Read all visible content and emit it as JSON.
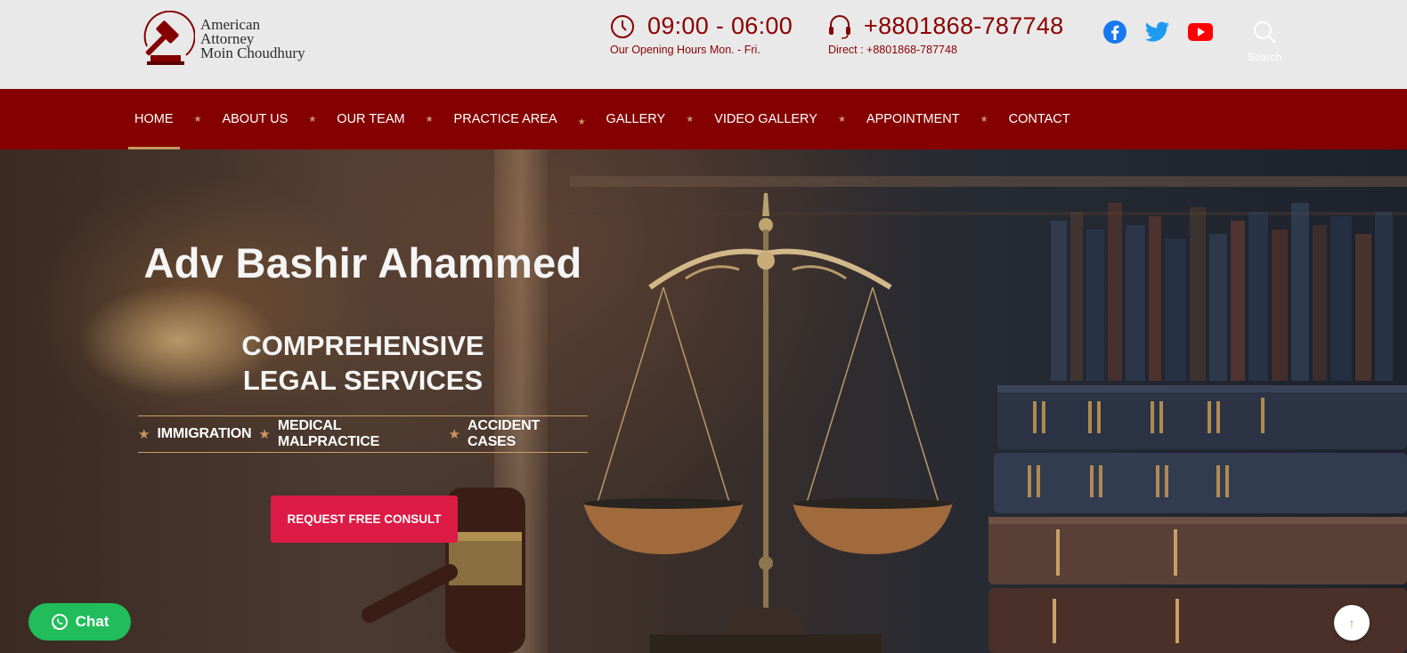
{
  "brand": {
    "logo_lines": [
      "American",
      "Attorney",
      "Moin Choudhury"
    ],
    "logo_icon": "gavel-icon",
    "primary_color": "#850000",
    "accent_color": "#c89862",
    "cta_color": "#dc1b46"
  },
  "header": {
    "hours": {
      "icon": "clock-icon",
      "value": "09:00 - 06:00",
      "caption": "Our Opening Hours Mon. - Fri."
    },
    "phone": {
      "icon": "headset-icon",
      "value": "+8801868-787748",
      "caption": "Direct : +8801868-787748"
    },
    "social": [
      {
        "icon": "facebook-icon",
        "color": "#1877f2"
      },
      {
        "icon": "twitter-icon",
        "color": "#1d9bf0"
      },
      {
        "icon": "youtube-icon",
        "color": "#ff0000"
      }
    ],
    "search": {
      "icon": "search-icon",
      "label": "Search"
    }
  },
  "nav": {
    "items": [
      {
        "label": "HOME",
        "active": true
      },
      {
        "label": "ABOUT US"
      },
      {
        "label": "OUR TEAM"
      },
      {
        "label": "PRACTICE AREA"
      },
      {
        "label": "GALLERY"
      },
      {
        "label": "VIDEO GALLERY"
      },
      {
        "label": "APPOINTMENT"
      },
      {
        "label": "CONTACT"
      }
    ]
  },
  "hero": {
    "name": "Adv Bashir Ahammed",
    "subtitle_line1": "COMPREHENSIVE",
    "subtitle_line2": "LEGAL SERVICES",
    "tags": [
      "IMMIGRATION",
      "MEDICAL MALPRACTICE",
      "ACCIDENT CASES"
    ],
    "cta_label": "REQUEST FREE CONSULT"
  },
  "floating": {
    "chat_label": "Chat",
    "chat_icon": "whatsapp-icon",
    "back_to_top_icon": "arrow-up-icon"
  }
}
